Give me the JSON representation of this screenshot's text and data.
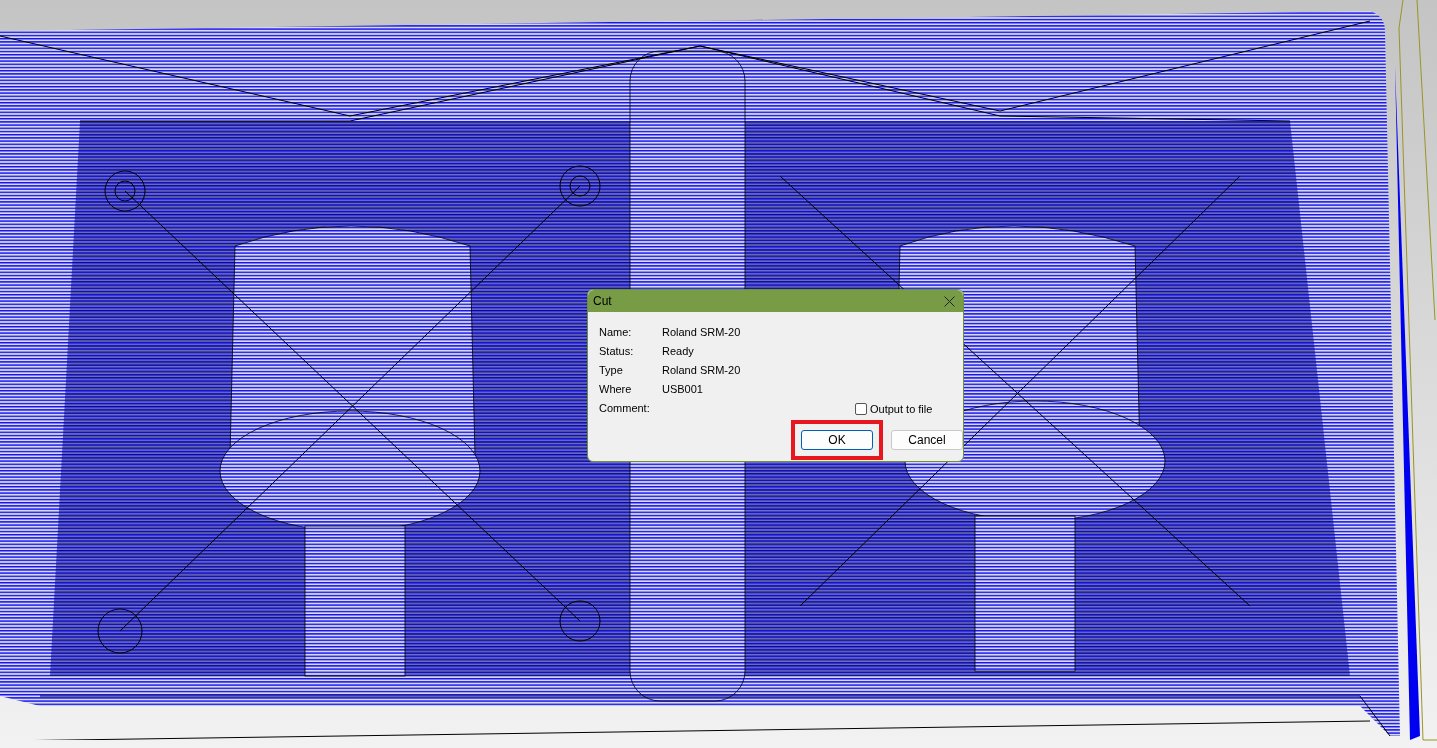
{
  "dialog": {
    "title": "Cut",
    "fields": [
      {
        "label": "Name:",
        "value": "Roland SRM-20"
      },
      {
        "label": "Status:",
        "value": "Ready"
      },
      {
        "label": "Type",
        "value": "Roland SRM-20"
      },
      {
        "label": "Where",
        "value": "USB001"
      },
      {
        "label": "Comment:"
      }
    ],
    "output_to_file": {
      "label": "Output to file",
      "checked": false
    },
    "buttons": [
      {
        "label": "OK",
        "highlighted": true,
        "default": true
      },
      {
        "label": "Cancel",
        "highlighted": false,
        "default": false
      }
    ]
  }
}
